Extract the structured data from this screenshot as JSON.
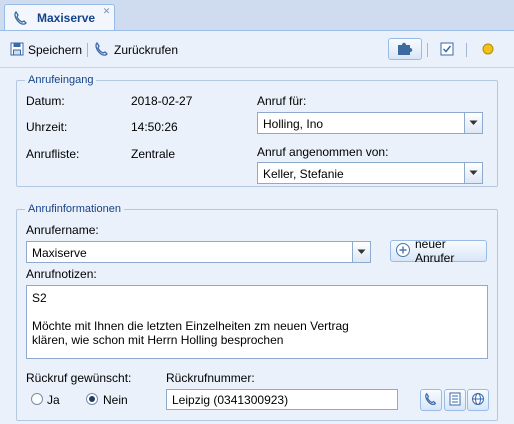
{
  "tab": {
    "title": "Maxiserve"
  },
  "toolbar": {
    "save_label": "Speichern",
    "callback_label": "Zurückrufen"
  },
  "eingang": {
    "legend": "Anrufeingang",
    "datum_label": "Datum:",
    "datum_value": "2018-02-27",
    "uhrzeit_label": "Uhrzeit:",
    "uhrzeit_value": "14:50:26",
    "liste_label": "Anrufliste:",
    "liste_value": "Zentrale",
    "fuer_label": "Anruf für:",
    "fuer_value": "Holling, Ino",
    "angenommen_label": "Anruf angenommen von:",
    "angenommen_value": "Keller, Stefanie"
  },
  "info": {
    "legend": "Anrufinformationen",
    "name_label": "Anrufername:",
    "name_value": "Maxiserve",
    "new_caller_label": "neuer Anrufer",
    "notes_label": "Anrufnotizen:",
    "notes_value": "S2\n\nMöchte mit Ihnen die letzten Einzelheiten zm neuen Vertrag\nklären, wie schon mit Herrn Holling besprochen",
    "rueckruf_label": "Rückruf gewünscht:",
    "ja_label": "Ja",
    "nein_label": "Nein",
    "selected": "Nein",
    "nummer_label": "Rückrufnummer:",
    "nummer_value": "Leipzig (0341300923)"
  }
}
